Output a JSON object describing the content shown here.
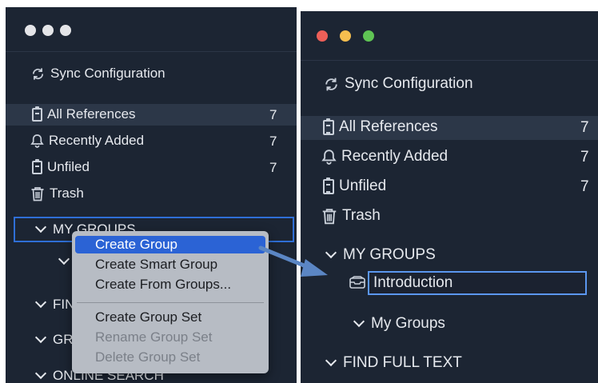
{
  "colors": {
    "sidebar_bg": "#1c2533",
    "selected_row": "#2c3748",
    "focus_blue": "#2f6fd6",
    "menu_bg": "#b7bcc4",
    "menu_highlight": "#2b63d5",
    "traffic_red": "#ed5f58",
    "traffic_yellow": "#f5be4f",
    "traffic_green": "#5fc454",
    "annotation_arrow": "#5b86c4"
  },
  "left_window": {
    "sync_label": "Sync Configuration",
    "library": [
      {
        "label": "All References",
        "count": "7",
        "icon": "clipboard-icon"
      },
      {
        "label": "Recently Added",
        "count": "7",
        "icon": "bell-icon"
      },
      {
        "label": "Unfiled",
        "count": "7",
        "icon": "clipboard-icon"
      },
      {
        "label": "Trash",
        "count": "",
        "icon": "trash-icon"
      }
    ],
    "my_groups_label": "MY GROUPS",
    "partial_find": "FIN",
    "partial_groups": "GR",
    "online_search_label": "ONLINE SEARCH"
  },
  "context_menu": {
    "items": [
      {
        "label": "Create Group",
        "state": "highlighted"
      },
      {
        "label": "Create Smart Group",
        "state": "enabled"
      },
      {
        "label": "Create From Groups...",
        "state": "enabled"
      },
      {
        "label": "Create Group Set",
        "state": "enabled"
      },
      {
        "label": "Rename Group Set",
        "state": "disabled"
      },
      {
        "label": "Delete Group Set",
        "state": "disabled"
      }
    ]
  },
  "right_window": {
    "sync_label": "Sync Configuration",
    "library": [
      {
        "label": "All References",
        "count": "7",
        "icon": "clipboard-icon"
      },
      {
        "label": "Recently Added",
        "count": "7",
        "icon": "bell-icon"
      },
      {
        "label": "Unfiled",
        "count": "7",
        "icon": "clipboard-icon"
      },
      {
        "label": "Trash",
        "count": "",
        "icon": "trash-icon"
      }
    ],
    "my_groups_label": "MY GROUPS",
    "new_group_value": "Introduction",
    "my_groups_set_label": "My Groups",
    "find_full_text_label": "FIND FULL TEXT"
  }
}
